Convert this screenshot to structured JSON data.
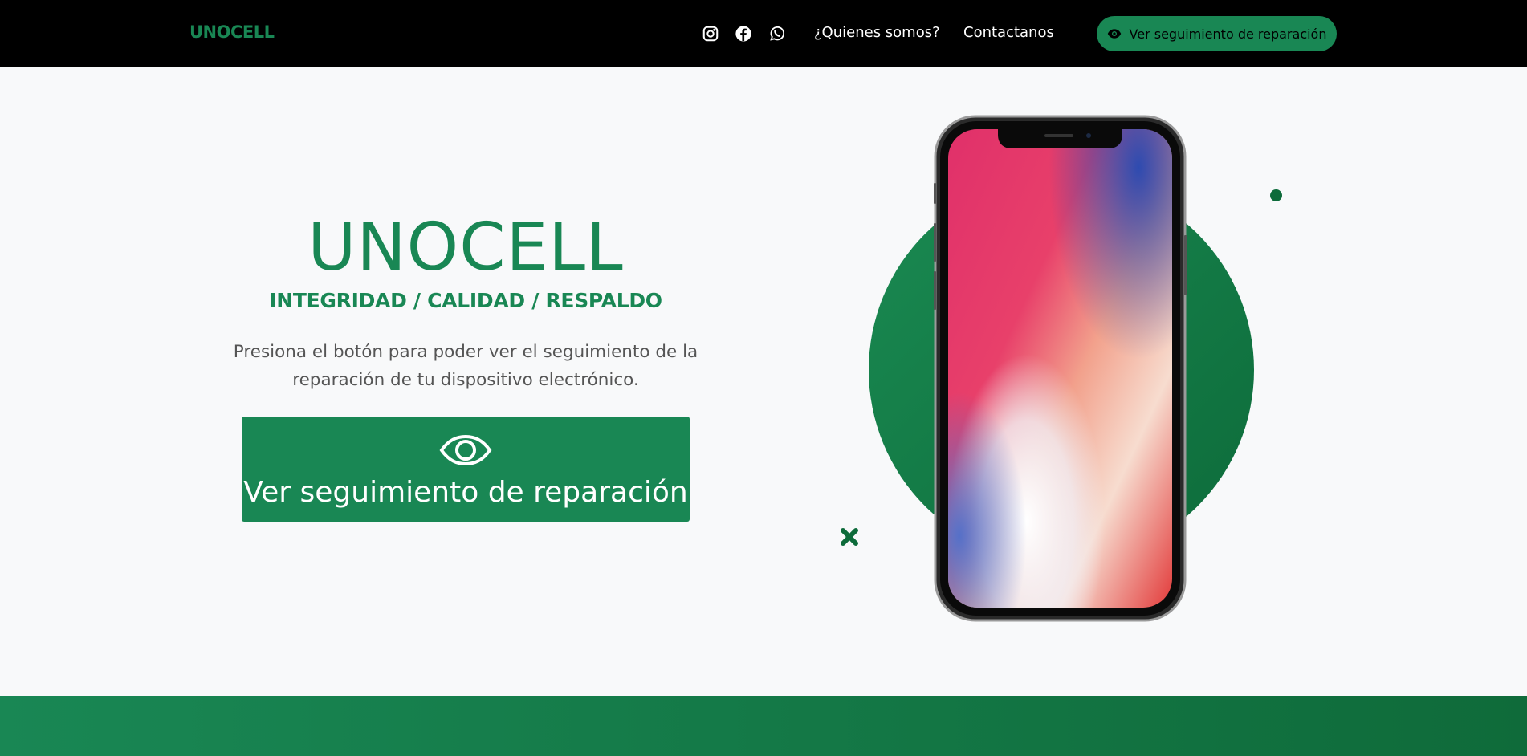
{
  "navbar": {
    "brand": "UNOCELL",
    "social_icons": [
      "instagram-icon",
      "facebook-icon",
      "whatsapp-icon"
    ],
    "links": [
      "¿Quienes somos?",
      "Contactanos"
    ],
    "cta_label": "Ver seguimiento de reparación",
    "cta_icon": "eye-icon"
  },
  "hero": {
    "title": "UNOCELL",
    "subtitle": "INTEGRIDAD / CALIDAD / RESPALDO",
    "description": "Presiona el botón para poder ver el seguimiento de la reparación de tu dispositivo electrónico.",
    "button_label": "Ver seguimiento de reparación",
    "button_icon": "eye-icon"
  },
  "illustration": {
    "image": "smartphone-illustration",
    "circle_color": "#198754",
    "accent_color": "#0d6b3a"
  },
  "colors": {
    "brand": "#198754",
    "navbar_bg": "#000000",
    "page_bg": "#f8f9fa"
  }
}
